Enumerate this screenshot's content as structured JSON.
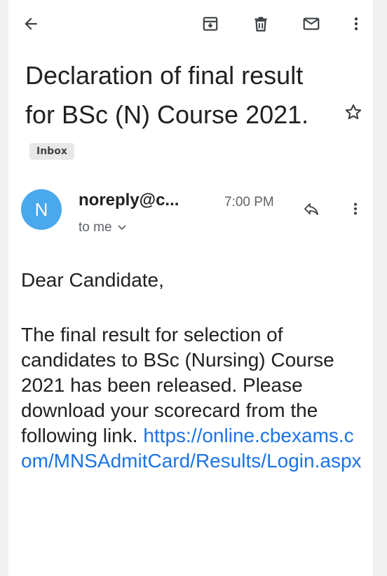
{
  "toolbar": {
    "back_icon": "arrow-back-icon",
    "archive_icon": "archive-icon",
    "delete_icon": "trash-icon",
    "mark_unread_icon": "mail-icon",
    "more_icon": "more-vert-icon"
  },
  "message": {
    "subject": "Declaration of final result for BSc (N) Course 2021.",
    "label": "Inbox",
    "star_icon": "star-outline-icon",
    "sender_initial": "N",
    "sender": "noreply@c...",
    "time": "7:00 PM",
    "recipient": "to me",
    "reply_icon": "reply-icon",
    "more_icon": "more-vert-icon",
    "greeting": "Dear Candidate,",
    "body": "The final result for selection of candidates to BSc (Nursing) Course 2021 has been released. Please download your scorecard from the following link.",
    "link": "https://online.cbexams.com/MNSAdmitCard/Results/Login.aspx"
  },
  "colors": {
    "avatar": "#4aa8ec",
    "link": "#1a73e8",
    "text": "#202124",
    "secondary": "#5f6368"
  }
}
